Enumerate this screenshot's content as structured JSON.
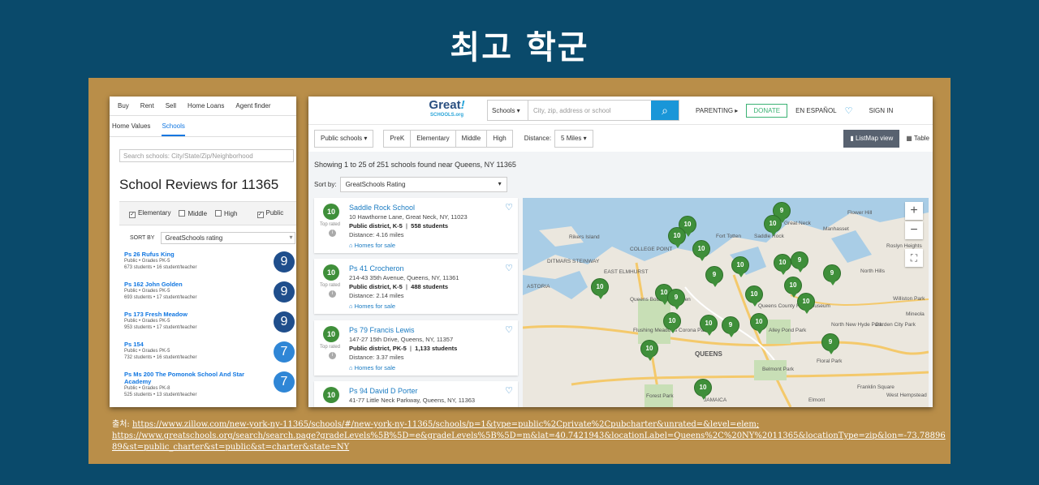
{
  "slide_title": "최고 학군",
  "zillow": {
    "nav": [
      "Buy",
      "Rent",
      "Sell",
      "Home Loans",
      "Agent finder"
    ],
    "subnav": [
      "Home Values",
      "Schools"
    ],
    "search_placeholder": "Search schools: City/State/Zip/Neighborhood",
    "heading": "School Reviews for 11365",
    "filters": [
      {
        "label": "Elementary",
        "checked": true
      },
      {
        "label": "Middle",
        "checked": false
      },
      {
        "label": "High",
        "checked": false
      },
      {
        "label": "Public",
        "checked": true
      }
    ],
    "sort_label": "SORT BY",
    "sort_value": "GreatSchools rating",
    "schools": [
      {
        "name": "Ps 26 Rufus King",
        "line1": "Public • Grades PK-5",
        "line2": "673 students • 16 student/teacher",
        "rating": "9",
        "color": "#1f4e8c"
      },
      {
        "name": "Ps 162 John Golden",
        "line1": "Public • Grades PK-5",
        "line2": "693 students • 17 student/teacher",
        "rating": "9",
        "color": "#1f4e8c"
      },
      {
        "name": "Ps 173 Fresh Meadow",
        "line1": "Public • Grades PK-5",
        "line2": "953 students • 17 student/teacher",
        "rating": "9",
        "color": "#1f4e8c"
      },
      {
        "name": "Ps 154",
        "line1": "Public • Grades PK-5",
        "line2": "732 students • 16 student/teacher",
        "rating": "7",
        "color": "#2f86d6"
      },
      {
        "name": "Ps Ms 200 The Pomonok School And Star Academy",
        "line1": "Public • Grades PK-8",
        "line2": "525 students • 13 student/teacher",
        "rating": "7",
        "color": "#2f86d6"
      }
    ]
  },
  "greatschools": {
    "logo_main": "Great",
    "logo_mark": "!",
    "logo_sub": "SCHOOLS.org",
    "search_dropdown": "Schools ▾",
    "search_placeholder": "City, zip, address or school",
    "search_icon": "magnifier",
    "nav": {
      "parenting": "PARENTING ▸",
      "donate": "DONATE",
      "espanol": "EN ESPAÑOL",
      "signin": "SIGN IN"
    },
    "filter": {
      "type": "Public schools",
      "grades": [
        "PreK",
        "Elementary",
        "Middle",
        "High"
      ],
      "distance_label": "Distance:",
      "distance_value": "5 Miles",
      "listmap": "ListMap view",
      "table": "Table"
    },
    "showing": "Showing 1 to 25 of 251 schools found near Queens, NY 11365",
    "sort_label": "Sort by:",
    "sort_value": "GreatSchools Rating",
    "top_rated": "Top rated",
    "homes_for_sale": "Homes for sale",
    "results": [
      {
        "name": "Saddle Rock School",
        "address": "10 Hawthorne Lane, Great Neck, NY, 11023",
        "type": "Public district, K-5",
        "students": "558 students",
        "distance": "Distance: 4.16 miles",
        "rating": "10"
      },
      {
        "name": "Ps 41 Crocheron",
        "address": "214-43 35th Avenue, Queens, NY, 11361",
        "type": "Public district, K-5",
        "students": "488 students",
        "distance": "Distance: 2.14 miles",
        "rating": "10"
      },
      {
        "name": "Ps 79 Francis Lewis",
        "address": "147-27 15th Drive, Queens, NY, 11357",
        "type": "Public district, PK-5",
        "students": "1,133 students",
        "distance": "Distance: 3.37 miles",
        "rating": "10"
      },
      {
        "name": "Ps 94 David D Porter",
        "address": "41-77 Little Neck Parkway, Queens, NY, 11363",
        "type": "",
        "students": "",
        "distance": "",
        "rating": "10"
      }
    ],
    "map_labels": [
      "Rikers Island",
      "Fort Totten",
      "Saddle Rock",
      "Great Neck",
      "Manhasset",
      "Flower Hill",
      "Roslyn Heights",
      "North Hills",
      "Queens Botanical Garden",
      "Flushing Meadows Corona Park",
      "QUEENS",
      "Queens County Farm Museum",
      "Alley Pond Park",
      "Belmont Park",
      "Floral Park",
      "Forest Park",
      "North New Hyde Park",
      "Garden City Park",
      "Mineola",
      "Franklin Square",
      "West Hempstead",
      "Elmont",
      "ASTORIA",
      "JAMAICA",
      "Williston Park",
      "COLLEGE POINT",
      "DITMARS STEINWAY",
      "EAST ELMHURST"
    ]
  },
  "source": {
    "label": "출처:",
    "url1": "https://www.zillow.com/new-york-ny-11365/schools/#/new-york-ny-11365/schools/p=1&type=public%2Cprivate%2Cpubcharter&unrated=&level=elem;",
    "url2": "https://www.greatschools.org/search/search.page?gradeLevels%5B%5D=e&gradeLevels%5B%5D=m&lat=40.7421943&locationLabel=Queens%2C%20NY%2011365&locationType=zip&lon=-73.7889689&st=public_charter&st=public&st=charter&state=NY"
  },
  "colors": {
    "background": "#0a4a6b",
    "frame": "#b98e49",
    "rating_green": "#3f8f3a",
    "link_blue": "#1a7bc2"
  }
}
